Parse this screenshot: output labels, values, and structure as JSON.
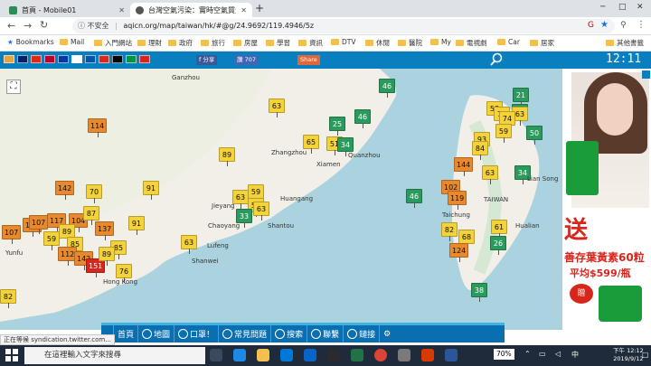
{
  "browser": {
    "tabs": [
      {
        "label": "首頁 - Mobile01",
        "favicon_color": "#2e8b57"
      },
      {
        "label": "台灣空氣污染：實時空氣質量指數",
        "favicon_color": "#555555"
      }
    ],
    "new_tab": "+",
    "insecure_label": "不安全",
    "url": "aqicn.org/map/taiwan/hk/#@g/24.9692/119.4946/5z",
    "bookmarks": [
      {
        "label": "Bookmarks"
      },
      {
        "label": "Mail"
      },
      {
        "label": "入門網站"
      },
      {
        "label": "理財"
      },
      {
        "label": "政府"
      },
      {
        "label": "旅行"
      },
      {
        "label": "房屋"
      },
      {
        "label": "學習"
      },
      {
        "label": "資訊"
      },
      {
        "label": "DTV"
      },
      {
        "label": "休閒"
      },
      {
        "label": "醫院"
      },
      {
        "label": "My"
      },
      {
        "label": "電視劇"
      },
      {
        "label": "Car"
      },
      {
        "label": "居家"
      },
      {
        "label": "其他書籤"
      }
    ]
  },
  "site": {
    "fb_share": "f 分享",
    "fb_like": "讚 707",
    "share": "Share",
    "clock": "12:11",
    "flag_colors": [
      "#e8a33d",
      "#012169",
      "#de2910",
      "#bc002d",
      "#0039a6",
      "#ffffff",
      "#0055a4",
      "#d52b1e",
      "#000000",
      "#009246",
      "#da251d"
    ]
  },
  "map": {
    "stations": [
      {
        "v": "114",
        "color": "#e8892e"
      },
      {
        "v": "63",
        "color": "#f3d23a"
      },
      {
        "v": "46",
        "color": "#2b9a5d"
      },
      {
        "v": "21",
        "color": "#2b9a5d"
      },
      {
        "v": "50",
        "color": "#2b9a5d"
      },
      {
        "v": "63",
        "color": "#f3d23a"
      },
      {
        "v": "58",
        "color": "#f3d23a"
      },
      {
        "v": "75",
        "color": "#f3d23a"
      },
      {
        "v": "74",
        "color": "#f3d23a"
      },
      {
        "v": "50",
        "color": "#2b9a5d"
      },
      {
        "v": "25",
        "color": "#2b9a5d"
      },
      {
        "v": "46",
        "color": "#2b9a5d"
      },
      {
        "v": "65",
        "color": "#f3d23a"
      },
      {
        "v": "51",
        "color": "#f3d23a"
      },
      {
        "v": "34",
        "color": "#2b9a5d"
      },
      {
        "v": "89",
        "color": "#f3d23a"
      },
      {
        "v": "59",
        "color": "#f3d23a"
      },
      {
        "v": "93",
        "color": "#f3d23a"
      },
      {
        "v": "84",
        "color": "#f3d23a"
      },
      {
        "v": "63",
        "color": "#f3d23a"
      },
      {
        "v": "34",
        "color": "#2b9a5d"
      },
      {
        "v": "142",
        "color": "#e8892e"
      },
      {
        "v": "70",
        "color": "#f3d23a"
      },
      {
        "v": "91",
        "color": "#f3d23a"
      },
      {
        "v": "59",
        "color": "#f3d23a"
      },
      {
        "v": "63",
        "color": "#f3d23a"
      },
      {
        "v": "52",
        "color": "#f3d23a"
      },
      {
        "v": "33",
        "color": "#2b9a5d"
      },
      {
        "v": "63",
        "color": "#f3d23a"
      },
      {
        "v": "144",
        "color": "#e8892e"
      },
      {
        "v": "102",
        "color": "#e8892e"
      },
      {
        "v": "119",
        "color": "#e8892e"
      },
      {
        "v": "46",
        "color": "#2b9a5d"
      },
      {
        "v": "109",
        "color": "#e8892e"
      },
      {
        "v": "107",
        "color": "#e8892e"
      },
      {
        "v": "117",
        "color": "#e8892e"
      },
      {
        "v": "104",
        "color": "#e8892e"
      },
      {
        "v": "87",
        "color": "#f3d23a"
      },
      {
        "v": "91",
        "color": "#f3d23a"
      },
      {
        "v": "137",
        "color": "#e8892e"
      },
      {
        "v": "82",
        "color": "#f3d23a"
      },
      {
        "v": "61",
        "color": "#f3d23a"
      },
      {
        "v": "107",
        "color": "#e8892e"
      },
      {
        "v": "59",
        "color": "#f3d23a"
      },
      {
        "v": "89",
        "color": "#f3d23a"
      },
      {
        "v": "85",
        "color": "#f3d23a"
      },
      {
        "v": "85",
        "color": "#f3d23a"
      },
      {
        "v": "63",
        "color": "#f3d23a"
      },
      {
        "v": "68",
        "color": "#f3d23a"
      },
      {
        "v": "26",
        "color": "#2b9a5d"
      },
      {
        "v": "112",
        "color": "#e8892e"
      },
      {
        "v": "142",
        "color": "#e8892e"
      },
      {
        "v": "124",
        "color": "#e8892e"
      },
      {
        "v": "151",
        "color": "#d9261c"
      },
      {
        "v": "76",
        "color": "#f3d23a"
      },
      {
        "v": "89",
        "color": "#f3d23a"
      },
      {
        "v": "82",
        "color": "#f3d23a"
      },
      {
        "v": "38",
        "color": "#2b9a5d"
      }
    ],
    "cities": [
      {
        "name": "Ganzhou"
      },
      {
        "name": "Zhangzhou"
      },
      {
        "name": "Xiamen"
      },
      {
        "name": "Quanzhou"
      },
      {
        "name": "Huangang"
      },
      {
        "name": "Jieyang"
      },
      {
        "name": "Chaoyang"
      },
      {
        "name": "Shantou"
      },
      {
        "name": "Lufeng"
      },
      {
        "name": "Shanwei"
      },
      {
        "name": "Hong Kong"
      },
      {
        "name": "Yunfu"
      },
      {
        "name": "TAIWAN"
      },
      {
        "name": "Taichung"
      },
      {
        "name": "Lian Song"
      },
      {
        "name": "Hualian"
      }
    ]
  },
  "ad": {
    "send": "送",
    "line1": "善存葉黃素60粒",
    "line2": "平均$599/瓶",
    "gift": "贈"
  },
  "bottom_nav": [
    {
      "label": "首頁"
    },
    {
      "label": "地圖"
    },
    {
      "label": "口罩！"
    },
    {
      "label": "常見問題"
    },
    {
      "label": "搜索"
    },
    {
      "label": "聯繫"
    },
    {
      "label": "鏈接"
    }
  ],
  "status_text": "正在等候 syndication.twitter.com...",
  "taskbar": {
    "search_placeholder": "在這裡輸入文字來搜尋",
    "tray_value": "70%",
    "time": "下午 12:12",
    "date": "2019/9/12"
  }
}
